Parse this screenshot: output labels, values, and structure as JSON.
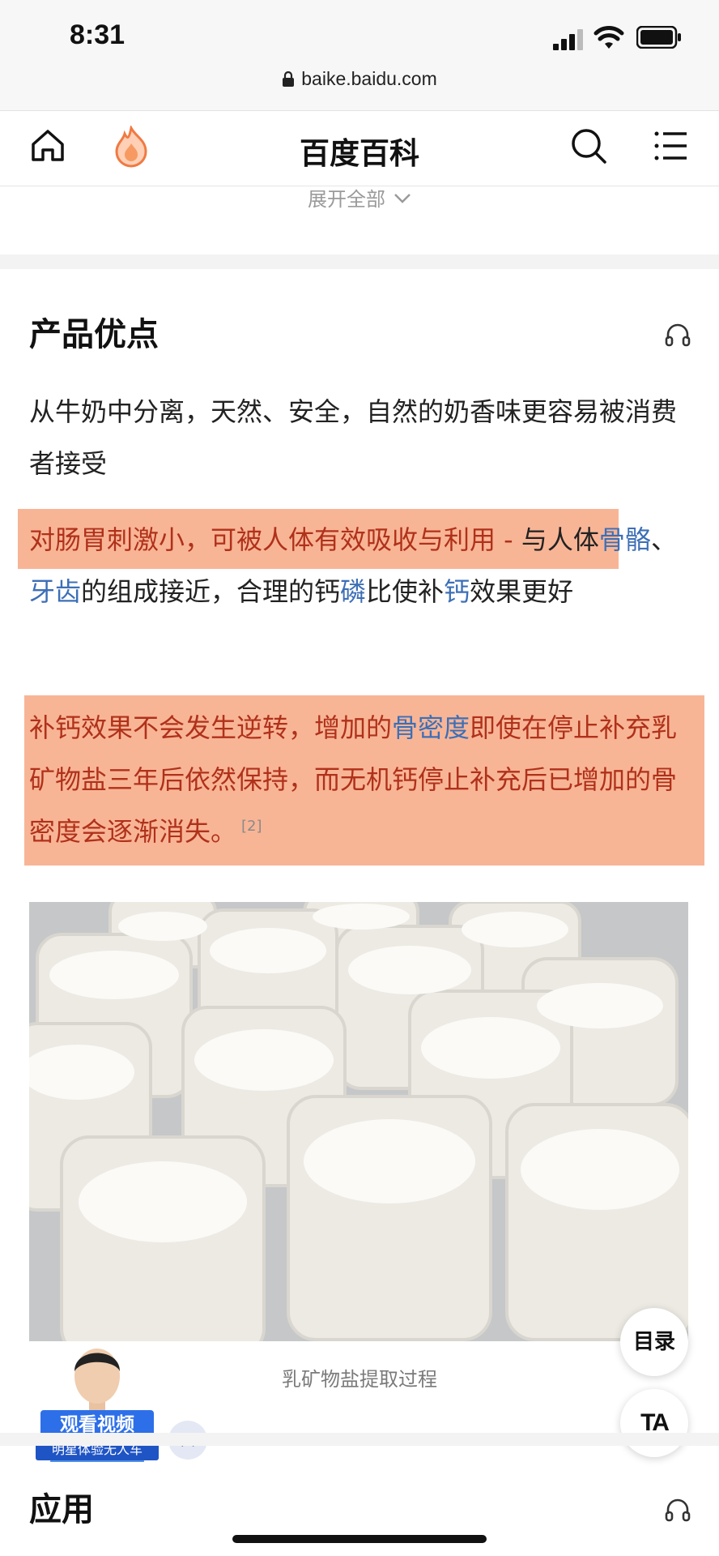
{
  "status_bar": {
    "time": "8:31",
    "url": "baike.baidu.com"
  },
  "nav": {
    "title": "百度百科",
    "icons": [
      "home-icon",
      "flame-icon",
      "search-icon",
      "menu-icon"
    ]
  },
  "expand_all": "展开全部",
  "section_advantages": {
    "title": "产品优点",
    "para1": "从牛奶中分离，天然、安全，自然的奶香味更容易被消费者接受",
    "para2": {
      "highlight": "对肠胃刺激小，可被人体有效吸收与利用 -",
      "text_a": " 与人体",
      "link1": "骨骼",
      "sep": "、",
      "link2": "牙齿",
      "text_b": "的组成接近，合理的钙",
      "link3": "磷",
      "text_c": "比使补",
      "link4": "钙",
      "text_d": "效果更好"
    },
    "para3": {
      "text_a": "补钙效果不会发生逆转，增加的",
      "link": "骨密度",
      "text_b": "即使在停止补充乳矿物盐三年后依然保持，而无机钙停止补充后已增加的骨密度会逐渐消失。",
      "ref": "[2]"
    }
  },
  "image_caption": "乳矿物盐提取过程",
  "floating": {
    "toc_label": "目录",
    "ta_label": "TA"
  },
  "promo": {
    "line1": "观看视频",
    "line2": "明星体验无人车",
    "close": "×"
  },
  "section_applications": {
    "title": "应用"
  },
  "colors": {
    "highlight_bg": "#f8b596",
    "highlight_text": "#b0311a",
    "link": "#3d6fb6"
  }
}
